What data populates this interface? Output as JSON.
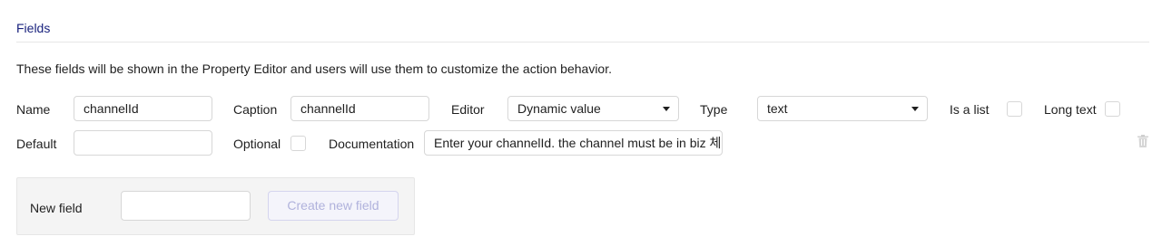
{
  "section": {
    "title": "Fields",
    "description": "These fields will be shown in the Property Editor and users will use them to customize the action behavior."
  },
  "field": {
    "name_label": "Name",
    "name_value": "channelId",
    "caption_label": "Caption",
    "caption_value": "channelId",
    "editor_label": "Editor",
    "editor_value": "Dynamic value",
    "type_label": "Type",
    "type_value": "text",
    "is_list_label": "Is a list",
    "is_list_checked": false,
    "long_text_label": "Long text",
    "long_text_checked": false,
    "default_label": "Default",
    "default_value": "",
    "optional_label": "Optional",
    "optional_checked": false,
    "documentation_label": "Documentation",
    "documentation_value": "Enter your channelId. the channel must be in biz 체"
  },
  "new_field": {
    "label": "New field",
    "input_value": "",
    "create_button": "Create new field"
  },
  "icons": {
    "delete": "trash-icon",
    "dropdown": "chevron-down-icon"
  },
  "colors": {
    "section_title": "#1a237e",
    "button_text_disabled": "#b0b2dc"
  }
}
